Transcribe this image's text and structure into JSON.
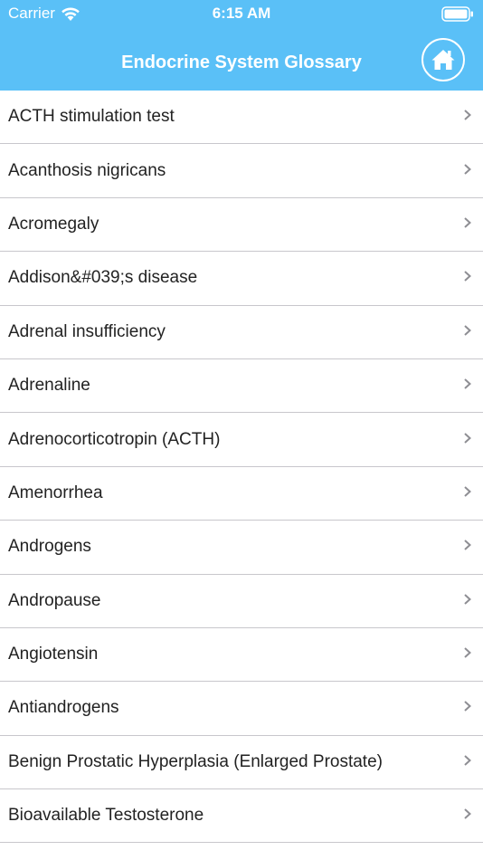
{
  "status_bar": {
    "carrier": "Carrier",
    "time": "6:15 AM"
  },
  "nav": {
    "title": "Endocrine System Glossary",
    "home_icon": "home-icon",
    "accent_color": "#5ac0f7"
  },
  "terms": [
    "ACTH stimulation test",
    "Acanthosis nigricans",
    "Acromegaly",
    "Addison&#039;s disease",
    "Adrenal insufficiency",
    "Adrenaline",
    "Adrenocorticotropin (ACTH)",
    "Amenorrhea",
    "Androgens",
    "Andropause",
    "Angiotensin",
    "Antiandrogens",
    "Benign Prostatic Hyperplasia (Enlarged Prostate)",
    "Bioavailable Testosterone"
  ]
}
